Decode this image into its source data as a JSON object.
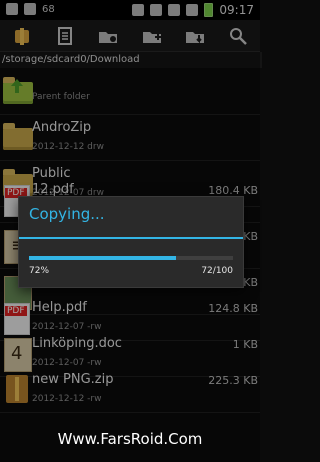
{
  "status": {
    "left_icons": [
      "usb-icon",
      "signal-bars-icon"
    ],
    "signal_number": "68",
    "right_icons": [
      "mute-icon",
      "alarm-icon",
      "wifi-icon",
      "signal-icon",
      "battery-icon"
    ],
    "time": "09:17"
  },
  "toolbar": {
    "icons": [
      "app-icon",
      "list-icon",
      "folder-network-icon",
      "folder-add-icon",
      "folder-download-icon",
      "search-icon"
    ]
  },
  "path": "/storage/sdcard0/Download",
  "files": [
    {
      "type": "parent",
      "name": "",
      "meta": "Parent folder",
      "size": ""
    },
    {
      "type": "folder",
      "name": "AndroZip",
      "meta": "2012-12-12 drw",
      "size": ""
    },
    {
      "type": "folder",
      "name": "Public",
      "meta": "2012-12-07 drw",
      "size": ""
    },
    {
      "type": "pdf",
      "name": "12.pdf",
      "meta": "",
      "size": "180.4 KB"
    },
    {
      "type": "doc",
      "name": "",
      "meta": "",
      "size": "KB"
    },
    {
      "type": "image",
      "name": "",
      "meta": "",
      "size": "KB"
    },
    {
      "type": "pdf",
      "name": "Help.pdf",
      "meta": "2012-12-07 -rw",
      "size": "124.8 KB"
    },
    {
      "type": "doc",
      "name": "Linköping.doc",
      "meta": "2012-12-07 -rw",
      "size": "1 KB"
    },
    {
      "type": "zip",
      "name": "new PNG.zip",
      "meta": "2012-12-12 -rw",
      "size": "225.3 KB"
    }
  ],
  "dialog": {
    "title": "Copying...",
    "progress_percent": "72%",
    "progress_value": 0.72,
    "count_text": "72/100"
  },
  "watermark": "Www.FarsRoid.Com",
  "colors": {
    "accent": "#33b5e5",
    "background": "#0b0b0b"
  }
}
